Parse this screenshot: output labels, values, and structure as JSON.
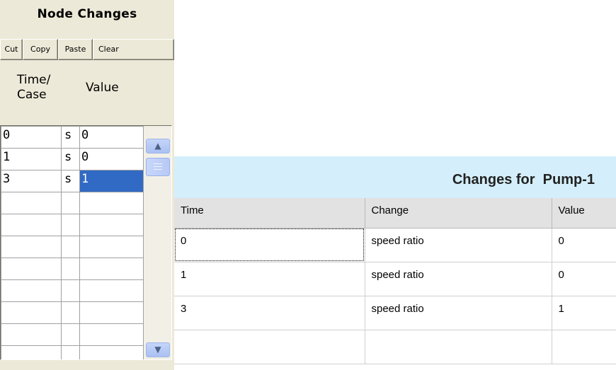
{
  "node_changes": {
    "title": "Node Changes",
    "buttons": {
      "cut": "Cut",
      "copy": "Copy",
      "paste": "Paste",
      "clear": "Clear"
    },
    "header_time": "Time/\nCase",
    "header_value": "Value",
    "rows": [
      {
        "time": "0",
        "unit": "s",
        "value": "0"
      },
      {
        "time": "1",
        "unit": "s",
        "value": "0"
      },
      {
        "time": "3",
        "unit": "s",
        "value": "1"
      }
    ],
    "selected_row": 2
  },
  "changes_panel": {
    "title": "Changes for  Pump-1",
    "columns": [
      "Time",
      "Change",
      "Value"
    ],
    "rows": [
      [
        "0",
        "speed ratio",
        "0"
      ],
      [
        "1",
        "speed ratio",
        "0"
      ],
      [
        "3",
        "speed ratio",
        "1"
      ]
    ]
  },
  "colors": {
    "selection": "#316ac5",
    "panel_bg": "#ece9d8",
    "header_bg": "#d4effb"
  }
}
